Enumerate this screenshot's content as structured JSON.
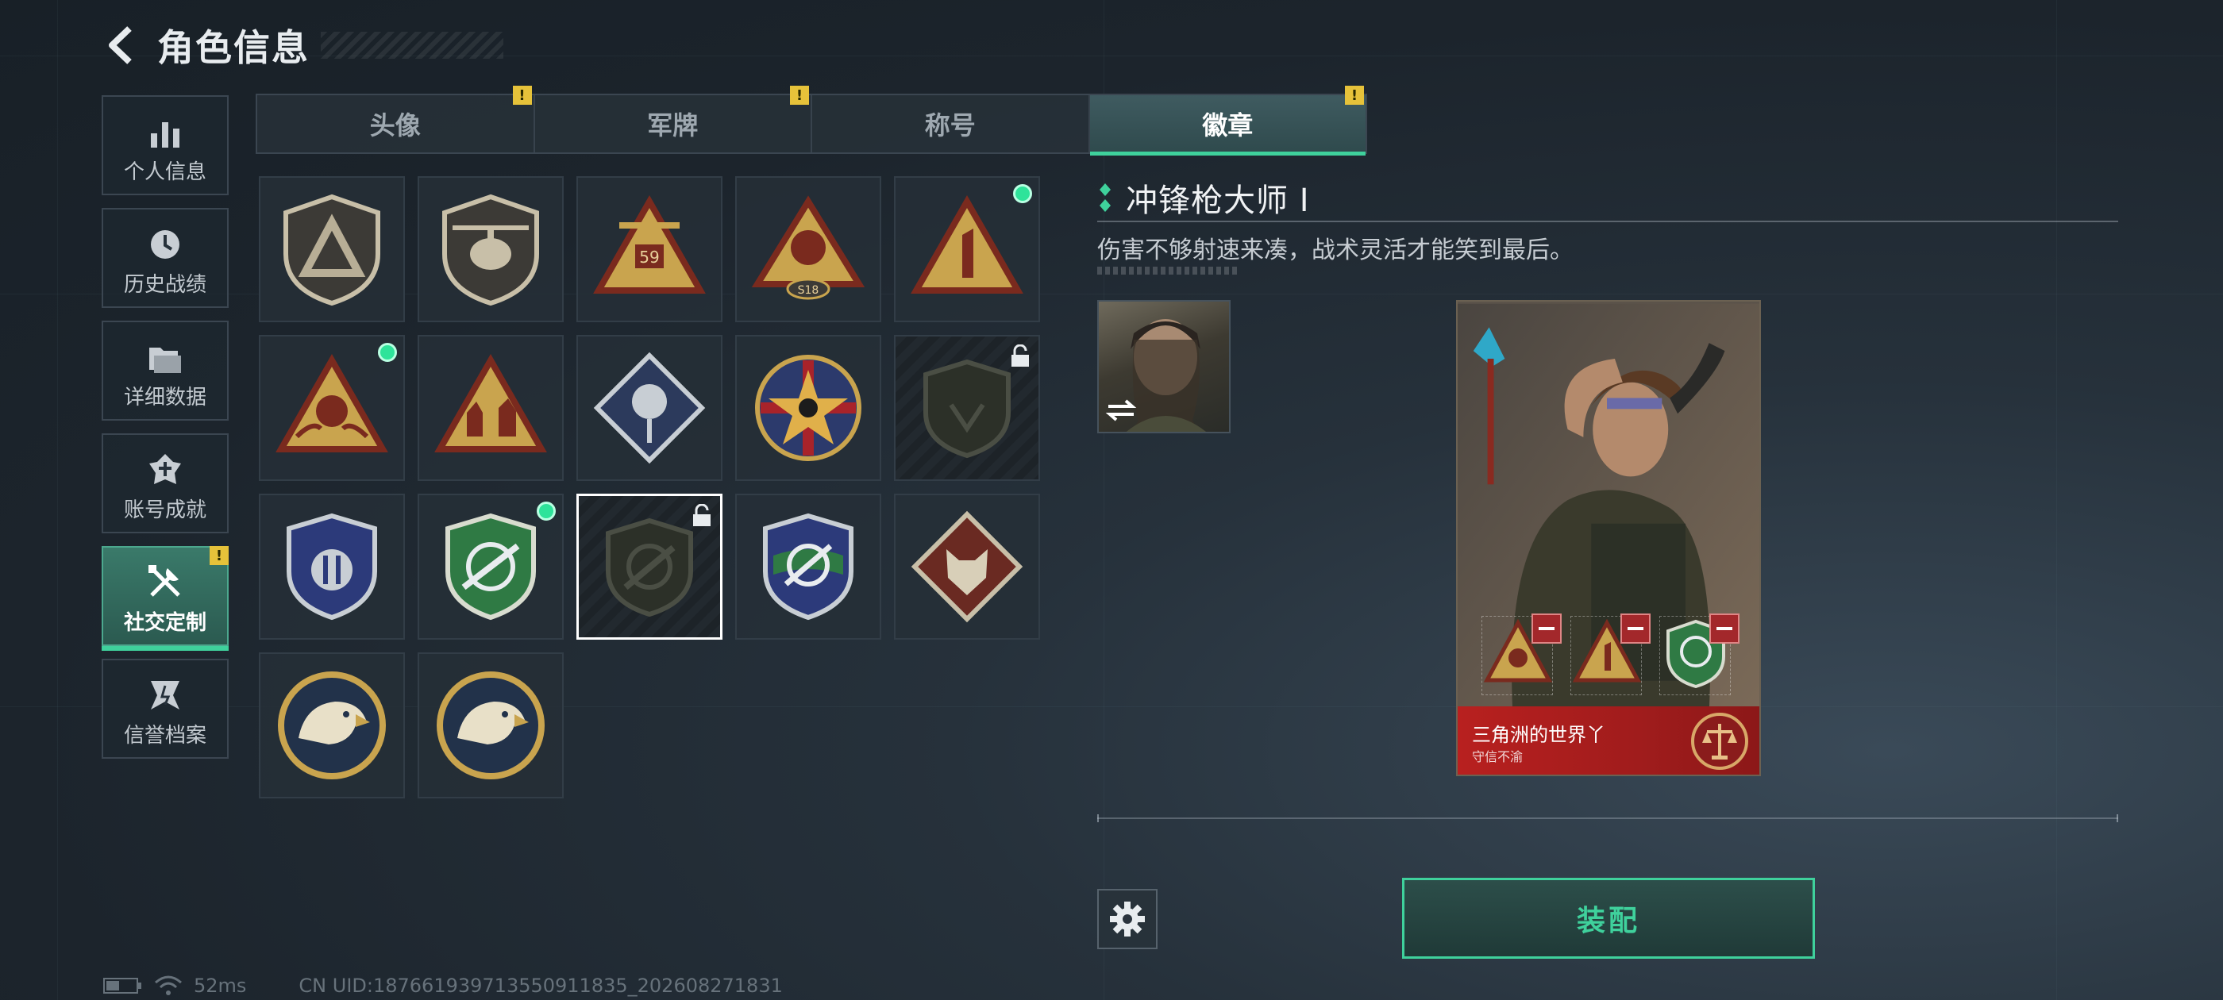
{
  "header": {
    "title": "角色信息"
  },
  "sidebar": {
    "items": [
      {
        "label": "个人信息",
        "icon": "bar-chart-icon",
        "active": false
      },
      {
        "label": "历史战绩",
        "icon": "history-clock-icon",
        "active": false
      },
      {
        "label": "详细数据",
        "icon": "folder-icon",
        "active": false
      },
      {
        "label": "账号成就",
        "icon": "achievement-icon",
        "active": false
      },
      {
        "label": "社交定制",
        "icon": "tools-icon",
        "active": true,
        "alert": "!"
      },
      {
        "label": "信誉档案",
        "icon": "reputation-icon",
        "active": false
      }
    ]
  },
  "tabs": [
    {
      "label": "头像",
      "alert": "!"
    },
    {
      "label": "军牌",
      "alert": "!"
    },
    {
      "label": "称号",
      "alert": ""
    },
    {
      "label": "徽章",
      "alert": "!",
      "active": true
    }
  ],
  "badges": [
    {
      "kind": "shield-triangle",
      "new": false,
      "locked": false
    },
    {
      "kind": "helicopter-shield",
      "new": false,
      "locked": false
    },
    {
      "kind": "triangle-59",
      "new": false,
      "locked": false
    },
    {
      "kind": "triangle-s18",
      "new": false,
      "locked": false
    },
    {
      "kind": "triangle-one",
      "new": true,
      "locked": false
    },
    {
      "kind": "triangle-hands",
      "new": true,
      "locked": false
    },
    {
      "kind": "triangle-squad",
      "new": false,
      "locked": false
    },
    {
      "kind": "diamond-rose",
      "new": false,
      "locked": false
    },
    {
      "kind": "star-round",
      "new": false,
      "locked": false
    },
    {
      "kind": "shield-dark",
      "new": false,
      "locked": true
    },
    {
      "kind": "shield-blue",
      "new": false,
      "locked": false
    },
    {
      "kind": "shield-green-smg",
      "new": true,
      "locked": false
    },
    {
      "kind": "shield-dark-smg",
      "new": false,
      "locked": true,
      "selected": true
    },
    {
      "kind": "shield-blue-smg",
      "new": false,
      "locked": false
    },
    {
      "kind": "diamond-wolf",
      "new": false,
      "locked": false
    },
    {
      "kind": "eagle-round",
      "new": false,
      "locked": false
    },
    {
      "kind": "eagle-round",
      "new": false,
      "locked": false
    }
  ],
  "detail": {
    "title": "冲锋枪大师 Ⅰ",
    "description": "伤害不够射速来凑，战术灵活才能笑到最后。"
  },
  "card": {
    "name": "三角洲的世界丫",
    "subtitle": "守信不渝"
  },
  "actions": {
    "equip_label": "装配"
  },
  "status": {
    "ping": "52ms",
    "uid": "CN UID:187661939713550911835_202608271831"
  },
  "colors": {
    "accent": "#3fd19c",
    "alert": "#e6c23a",
    "card_red": "#b8201f"
  }
}
